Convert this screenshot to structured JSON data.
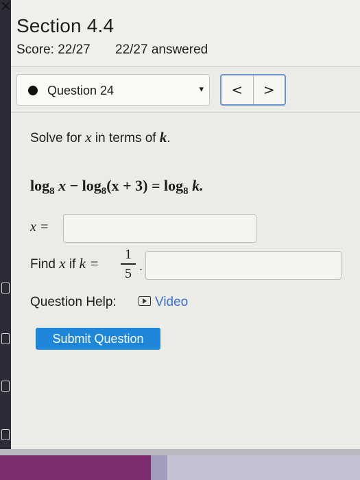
{
  "header": {
    "title": "Section 4.4",
    "score": "Score: 22/27",
    "answered": "22/27 answered"
  },
  "question_nav": {
    "label": "Question 24",
    "caret": "▾",
    "prev": "<",
    "next": ">"
  },
  "problem": {
    "prompt_pre": "Solve for ",
    "prompt_var": "x",
    "prompt_mid": " in terms of ",
    "prompt_k": "k",
    "prompt_end": ".",
    "equation": {
      "log1": "log",
      "base1": "8",
      "arg1": " x",
      "minus": " − ",
      "log2": "log",
      "base2": "8",
      "arg2": "(x + 3)",
      "equals": " = ",
      "log3": "log",
      "base3": "8",
      "arg3": " k."
    }
  },
  "answer1": {
    "label": "x =",
    "value": ""
  },
  "answer2": {
    "label_pre": "Find ",
    "label_var": "x",
    "label_mid": " if ",
    "label_k": "k =",
    "frac_num": "1",
    "frac_den": "5",
    "frac_dot": ".",
    "value": ""
  },
  "help": {
    "label": "Question Help:",
    "video_icon": "play-icon",
    "video_label": "Video"
  },
  "submit": {
    "label": "Submit Question"
  },
  "colors": {
    "accent": "#1f87d9",
    "link": "#3b6fd4",
    "nav_border": "#6c8fce"
  }
}
